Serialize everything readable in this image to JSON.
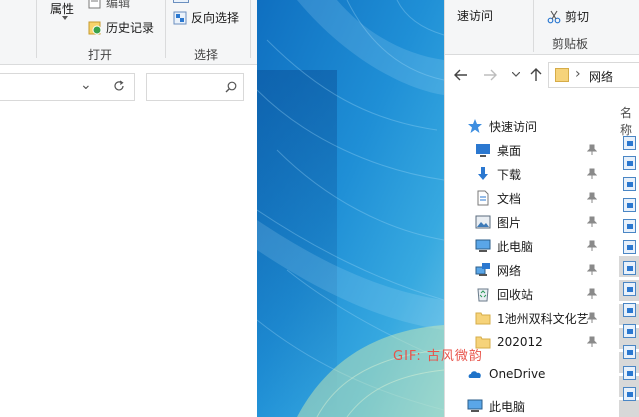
{
  "left_window": {
    "ribbon": {
      "open_group": {
        "properties_label": "属性",
        "edit_label": "编辑",
        "history_label": "历史记录",
        "group_label": "打开"
      },
      "select_group": {
        "invert_label": "反向选择",
        "group_label": "选择"
      }
    },
    "address_chevron": "⌄",
    "refresh_icon": "refresh-icon",
    "search_icon": "search-icon"
  },
  "right_window": {
    "ribbon": {
      "quick_access_label": "速访问",
      "cut_label": "剪切",
      "clipboard_label": "剪贴板"
    },
    "breadcrumb": {
      "path_label": "网络",
      "separator": "›"
    },
    "column_header": "名称",
    "nav": {
      "quick_access": "快速访问",
      "items": [
        {
          "label": "桌面",
          "icon": "desktop-icon",
          "pinned": true
        },
        {
          "label": "下载",
          "icon": "download-icon",
          "pinned": true
        },
        {
          "label": "文档",
          "icon": "document-icon",
          "pinned": true
        },
        {
          "label": "图片",
          "icon": "picture-icon",
          "pinned": true
        },
        {
          "label": "此电脑",
          "icon": "computer-icon",
          "pinned": true
        },
        {
          "label": "网络",
          "icon": "network-icon",
          "pinned": true
        },
        {
          "label": "回收站",
          "icon": "recycle-bin-icon",
          "pinned": true
        },
        {
          "label": "1池州双科文化艺",
          "icon": "folder-icon",
          "pinned": true
        },
        {
          "label": "202012",
          "icon": "folder-icon",
          "pinned": true
        }
      ],
      "onedrive": "OneDrive",
      "this_pc": "此电脑"
    }
  },
  "watermark": "GIF: 古风微韵",
  "colors": {
    "ribbon_bg": "#f5f6f7",
    "accent_blue": "#2b78d0",
    "folder_yellow": "#f6d37a",
    "watermark_red": "#e8544b"
  }
}
